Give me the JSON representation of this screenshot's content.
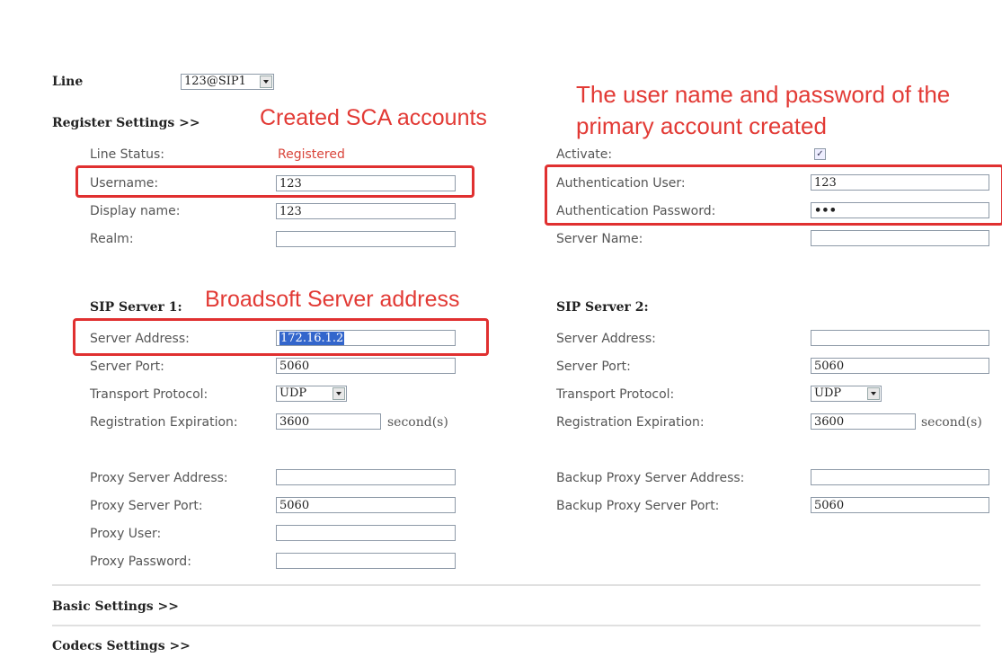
{
  "line": {
    "label": "Line",
    "value": "123@SIP1"
  },
  "register_settings": {
    "title": "Register Settings >>"
  },
  "left": {
    "line_status": {
      "label": "Line Status:",
      "value": "Registered"
    },
    "username": {
      "label": "Username:",
      "value": "123"
    },
    "display_name": {
      "label": "Display name:",
      "value": "123"
    },
    "realm": {
      "label": "Realm:",
      "value": ""
    }
  },
  "right": {
    "activate": {
      "label": "Activate:",
      "checked": true
    },
    "auth_user": {
      "label": "Authentication User:",
      "value": "123"
    },
    "auth_password": {
      "label": "Authentication Password:",
      "value": "•••"
    },
    "server_name": {
      "label": "Server Name:",
      "value": ""
    }
  },
  "sip1": {
    "title": "SIP Server 1:",
    "server_address": {
      "label": "Server Address:",
      "value": "172.16.1.2"
    },
    "server_port": {
      "label": "Server Port:",
      "value": "5060"
    },
    "transport": {
      "label": "Transport Protocol:",
      "value": "UDP"
    },
    "expiration": {
      "label": "Registration Expiration:",
      "value": "3600",
      "unit": "second(s)"
    }
  },
  "sip2": {
    "title": "SIP Server 2:",
    "server_address": {
      "label": "Server Address:",
      "value": ""
    },
    "server_port": {
      "label": "Server Port:",
      "value": "5060"
    },
    "transport": {
      "label": "Transport Protocol:",
      "value": "UDP"
    },
    "expiration": {
      "label": "Registration Expiration:",
      "value": "3600",
      "unit": "second(s)"
    }
  },
  "proxy": {
    "address": {
      "label": "Proxy Server Address:",
      "value": ""
    },
    "port": {
      "label": "Proxy Server Port:",
      "value": "5060"
    },
    "user": {
      "label": "Proxy User:",
      "value": ""
    },
    "password": {
      "label": "Proxy Password:",
      "value": ""
    }
  },
  "backup_proxy": {
    "address": {
      "label": "Backup Proxy Server Address:",
      "value": ""
    },
    "port": {
      "label": "Backup Proxy Server Port:",
      "value": "5060"
    }
  },
  "sections": {
    "basic": "Basic Settings >>",
    "codecs": "Codecs Settings >>"
  },
  "annotations": {
    "sca": "Created SCA accounts",
    "primary_line1": "The user name and password of the",
    "primary_line2": "primary account created",
    "broadsoft": "Broadsoft Server address"
  },
  "colors": {
    "annotation": "#e23a35",
    "registered": "#d9453b"
  }
}
